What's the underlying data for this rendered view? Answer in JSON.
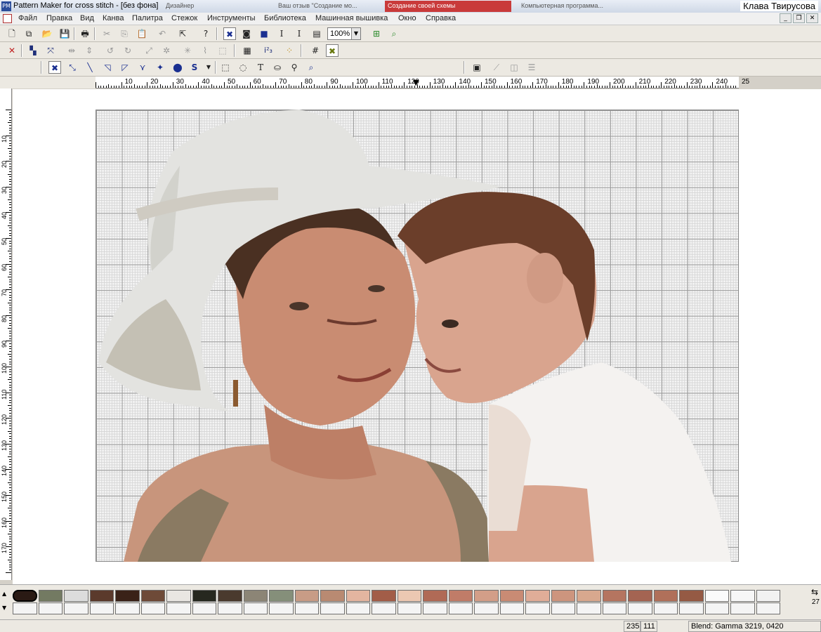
{
  "title_bar": {
    "app_title": "Pattern Maker for cross stitch - [без фона]",
    "bg_tabs": [
      "Дизайнер",
      "Ваш отзыв \"Создание мо...",
      "Создание своей схемы",
      "Компьютерная программа..."
    ],
    "user_name": "Клава Твирусова"
  },
  "menu": [
    "Файл",
    "Правка",
    "Вид",
    "Канва",
    "Палитра",
    "Стежок",
    "Инструменты",
    "Библиотека",
    "Машинная вышивка",
    "Окно",
    "Справка"
  ],
  "window_buttons": [
    "_",
    "❐",
    "✕"
  ],
  "toolbar1": {
    "zoom_value": "100%"
  },
  "ruler": {
    "h_labels": [
      "10",
      "20",
      "30",
      "40",
      "50",
      "60",
      "70",
      "80",
      "90",
      "100",
      "110",
      "120",
      "130",
      "140",
      "150",
      "160",
      "170",
      "180",
      "190",
      "200",
      "210",
      "220",
      "230",
      "240",
      "25"
    ],
    "v_labels": [
      "10",
      "20",
      "30",
      "40",
      "50",
      "60",
      "70",
      "80",
      "90",
      "100",
      "110",
      "120",
      "130",
      "140",
      "150",
      "160",
      "170"
    ]
  },
  "palette": {
    "colors": [
      "#2a1a14",
      "#737a62",
      "#dcdcdc",
      "#5b3a2c",
      "#3a2218",
      "#6e4a38",
      "#e9e6e2",
      "#26281f",
      "#4a3a2e",
      "#8c8576",
      "#858f7a",
      "#c89c86",
      "#b98a72",
      "#e3b5a0",
      "#a25d48",
      "#ecc8b2",
      "#b06a56",
      "#c07c68",
      "#d39e88",
      "#c98b74",
      "#e0ad98",
      "#cd957e",
      "#d8a88e",
      "#b57560",
      "#a46452",
      "#b0705a",
      "#955a44",
      "#fbfbfb",
      "#f7f7f7",
      "#f2f2f2"
    ],
    "page_number": "27"
  },
  "status": {
    "x": "235",
    "y": "111",
    "blend": "Blend: Gamma 3219, 0420"
  }
}
